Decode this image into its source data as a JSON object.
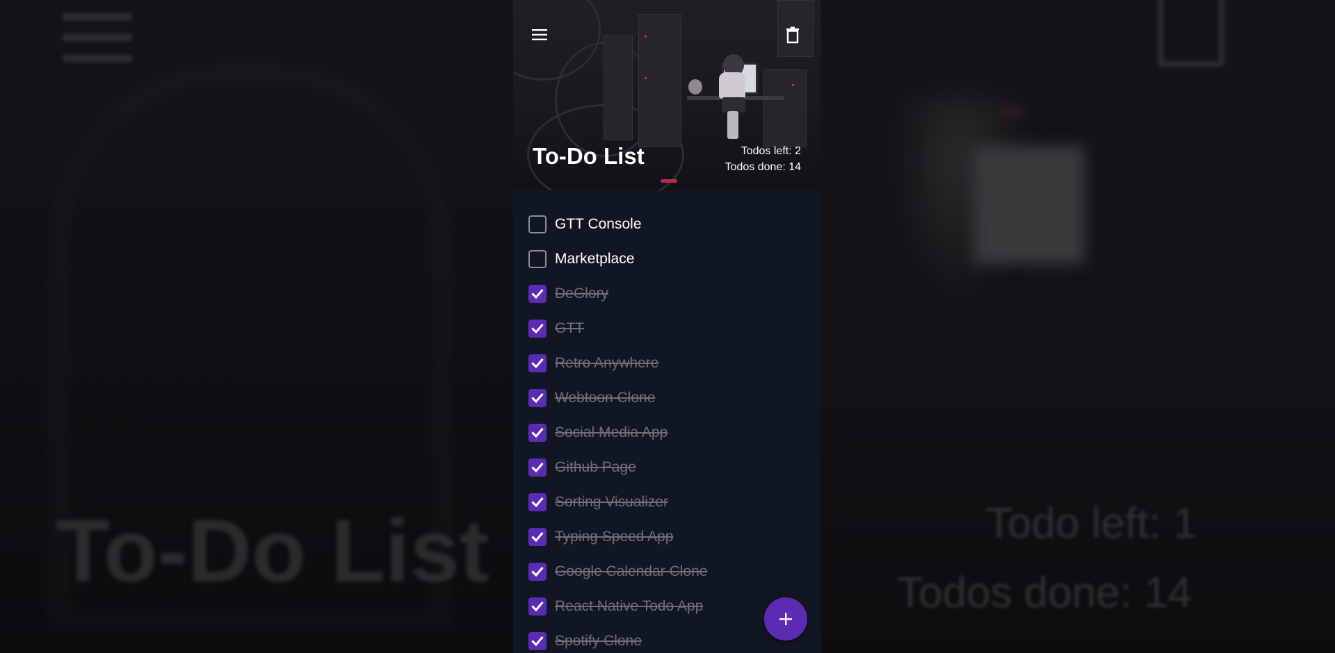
{
  "header": {
    "title": "To-Do List",
    "todos_left": "Todos left: 2",
    "todos_done": "Todos done: 14",
    "menu_icon": "menu-icon",
    "delete_icon": "trash-icon"
  },
  "todos": [
    {
      "label": "GTT Console",
      "done": false
    },
    {
      "label": "Marketplace",
      "done": false
    },
    {
      "label": "DeGlory",
      "done": true
    },
    {
      "label": "GTT",
      "done": true
    },
    {
      "label": "Retro Anywhere",
      "done": true
    },
    {
      "label": "Webtoon Clone",
      "done": true
    },
    {
      "label": "Social Media App",
      "done": true
    },
    {
      "label": "Github Page",
      "done": true
    },
    {
      "label": "Sorting Visualizer",
      "done": true
    },
    {
      "label": "Typing Speed App",
      "done": true
    },
    {
      "label": "Google Calendar Clone",
      "done": true
    },
    {
      "label": "React Native Todo App",
      "done": true
    },
    {
      "label": "Spotify Clone",
      "done": true
    }
  ],
  "fab": {
    "icon": "plus-icon"
  },
  "backdrop": {
    "title": "To-Do List",
    "todo_left": "Todo left: 1",
    "todos_done": "Todos done: 14"
  },
  "colors": {
    "accent": "#5b2bb5",
    "list_background": "#111722",
    "done_text": "#6c7079"
  }
}
